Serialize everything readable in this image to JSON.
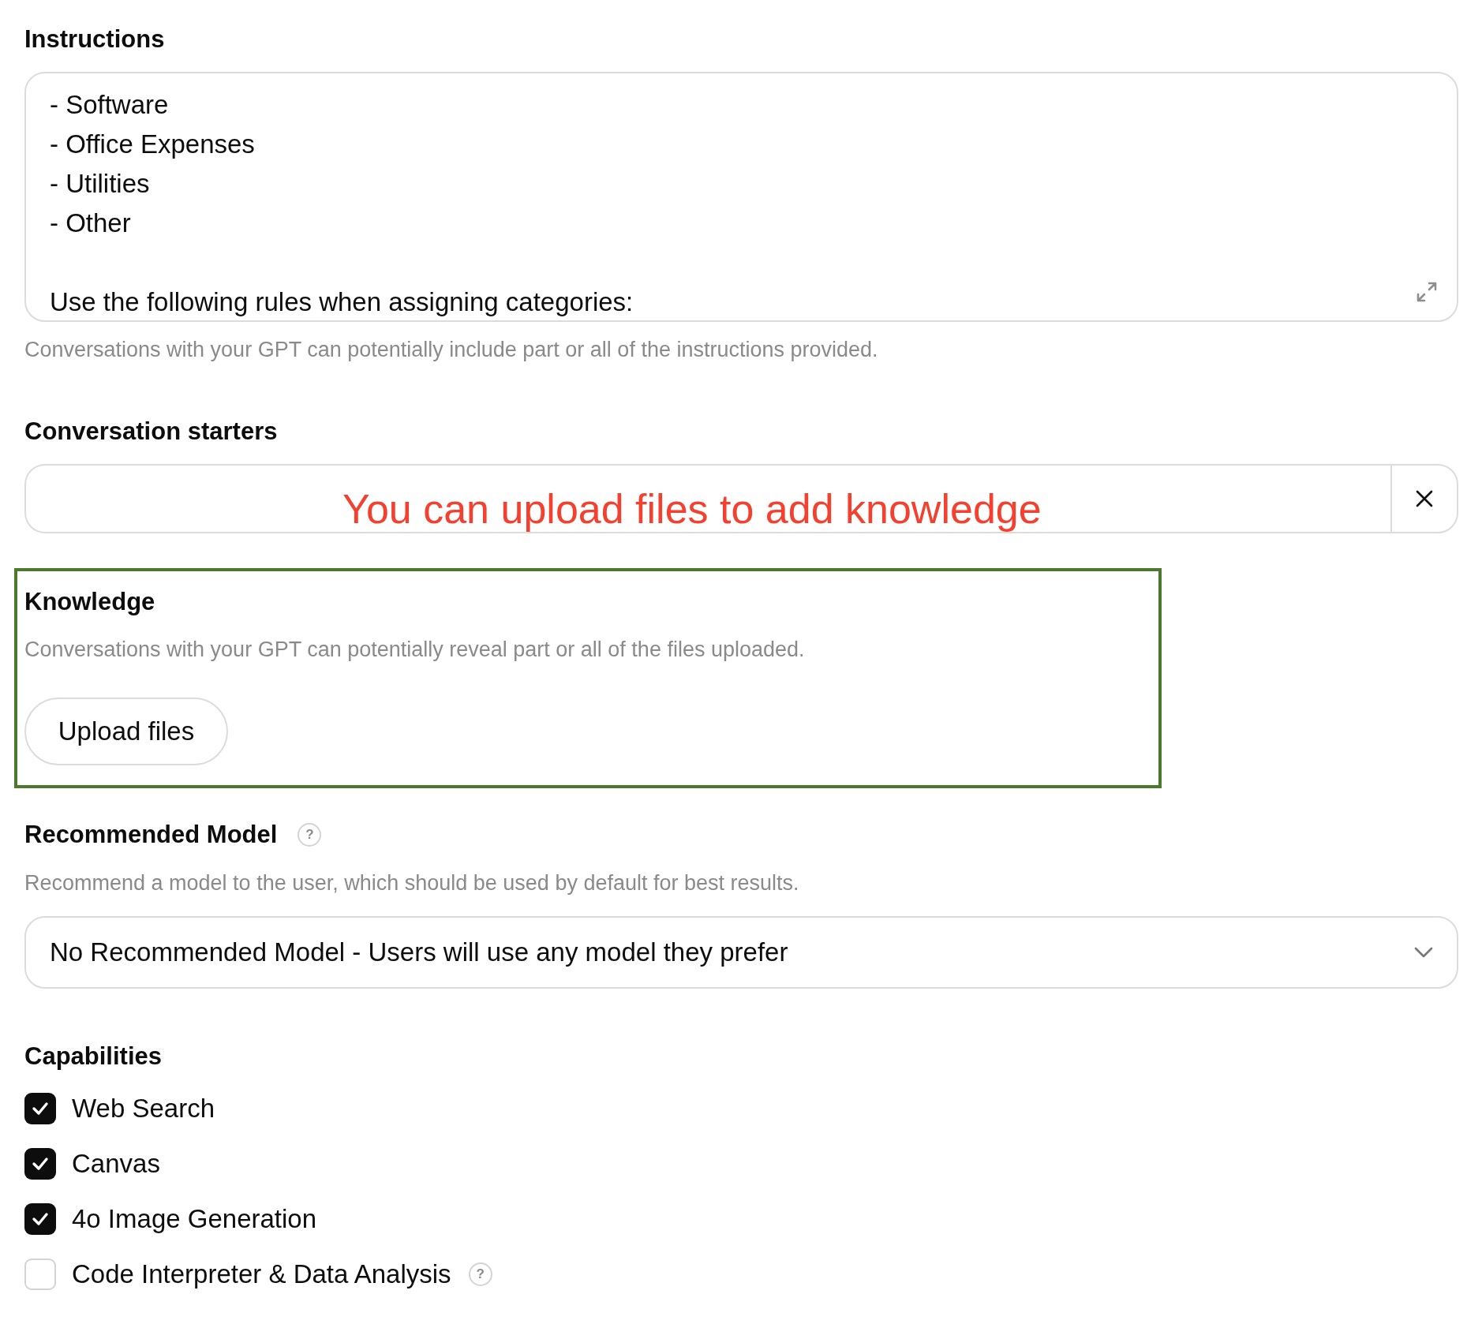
{
  "instructions": {
    "label": "Instructions",
    "lines": [
      "- Software",
      "- Office Expenses",
      "- Utilities",
      "- Other"
    ],
    "rules_line": "Use the following rules when assigning categories:",
    "caption": "Conversations with your GPT can potentially include part or all of the instructions provided."
  },
  "conversation_starters": {
    "label": "Conversation starters"
  },
  "annotation": {
    "text": "You can upload files to add knowledge"
  },
  "knowledge": {
    "label": "Knowledge",
    "caption": "Conversations with your GPT can potentially reveal part or all of the files uploaded.",
    "upload_button": "Upload files"
  },
  "recommended_model": {
    "label": "Recommended Model",
    "help": "?",
    "caption": "Recommend a model to the user, which should be used by default for best results.",
    "value": "No Recommended Model - Users will use any model they prefer"
  },
  "capabilities": {
    "label": "Capabilities",
    "items": [
      {
        "label": "Web Search",
        "checked": true
      },
      {
        "label": "Canvas",
        "checked": true
      },
      {
        "label": "4o Image Generation",
        "checked": true
      },
      {
        "label": "Code Interpreter & Data Analysis",
        "checked": false,
        "help": "?"
      }
    ]
  }
}
